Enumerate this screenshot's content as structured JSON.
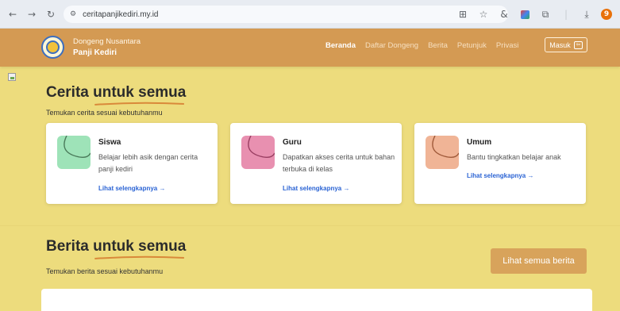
{
  "browser": {
    "url": "ceritapanjikediri.my.id",
    "profile_initial": "9"
  },
  "header": {
    "brand_top": "Dongeng Nusantara",
    "brand_bottom": "Panji Kediri",
    "nav": [
      "Beranda",
      "Daftar Dongeng",
      "Berita",
      "Petunjuk",
      "Privasi"
    ],
    "active_nav": "Beranda",
    "login_label": "Masuk"
  },
  "cerita": {
    "title_prefix": "Cerita ",
    "title_highlight": "untuk semua",
    "subtitle": "Temukan cerita sesuai kebutuhanmu",
    "cards": [
      {
        "title": "Siswa",
        "desc": "Belajar lebih asik dengan cerita panji kediri",
        "link": "Lihat selengkapnya →",
        "color": "#9ee3b8"
      },
      {
        "title": "Guru",
        "desc": "Dapatkan akses cerita untuk bahan terbuka di kelas",
        "link": "Lihat selengkapnya →",
        "color": "#e890b0"
      },
      {
        "title": "Umum",
        "desc": "Bantu tingkatkan belajar anak",
        "link": "Lihat selengkapnya →",
        "color": "#f0b496"
      }
    ]
  },
  "berita": {
    "title_prefix": "Berita ",
    "title_highlight": "untuk semua",
    "subtitle": "Temukan berita sesuai kebutuhanmu",
    "see_all_label": "Lihat semua berita"
  },
  "colors": {
    "page_bg": "#eddc7d",
    "header_bg": "#d49a53",
    "accent_underline": "#d9893a",
    "link": "#2a63d4",
    "button": "#d8a35b"
  }
}
